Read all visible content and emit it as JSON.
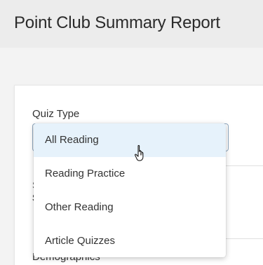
{
  "header": {
    "title": "Point Club Summary Report"
  },
  "form": {
    "quiz_type_label": "Quiz Type",
    "peek_label_1": "S",
    "peek_label_2": "S",
    "demographics_label": "Demographics"
  },
  "dropdown": {
    "options": [
      {
        "label": "All Reading",
        "selected": true
      },
      {
        "label": "Reading Practice",
        "selected": false
      },
      {
        "label": "Other Reading",
        "selected": false
      },
      {
        "label": "Article Quizzes",
        "selected": false
      }
    ]
  },
  "colors": {
    "header_bg": "#ececec",
    "selected_option_bg": "#e6f2fb",
    "field_border": "#8fa9c2"
  },
  "icons": {
    "cursor": "hand-pointer-icon"
  }
}
